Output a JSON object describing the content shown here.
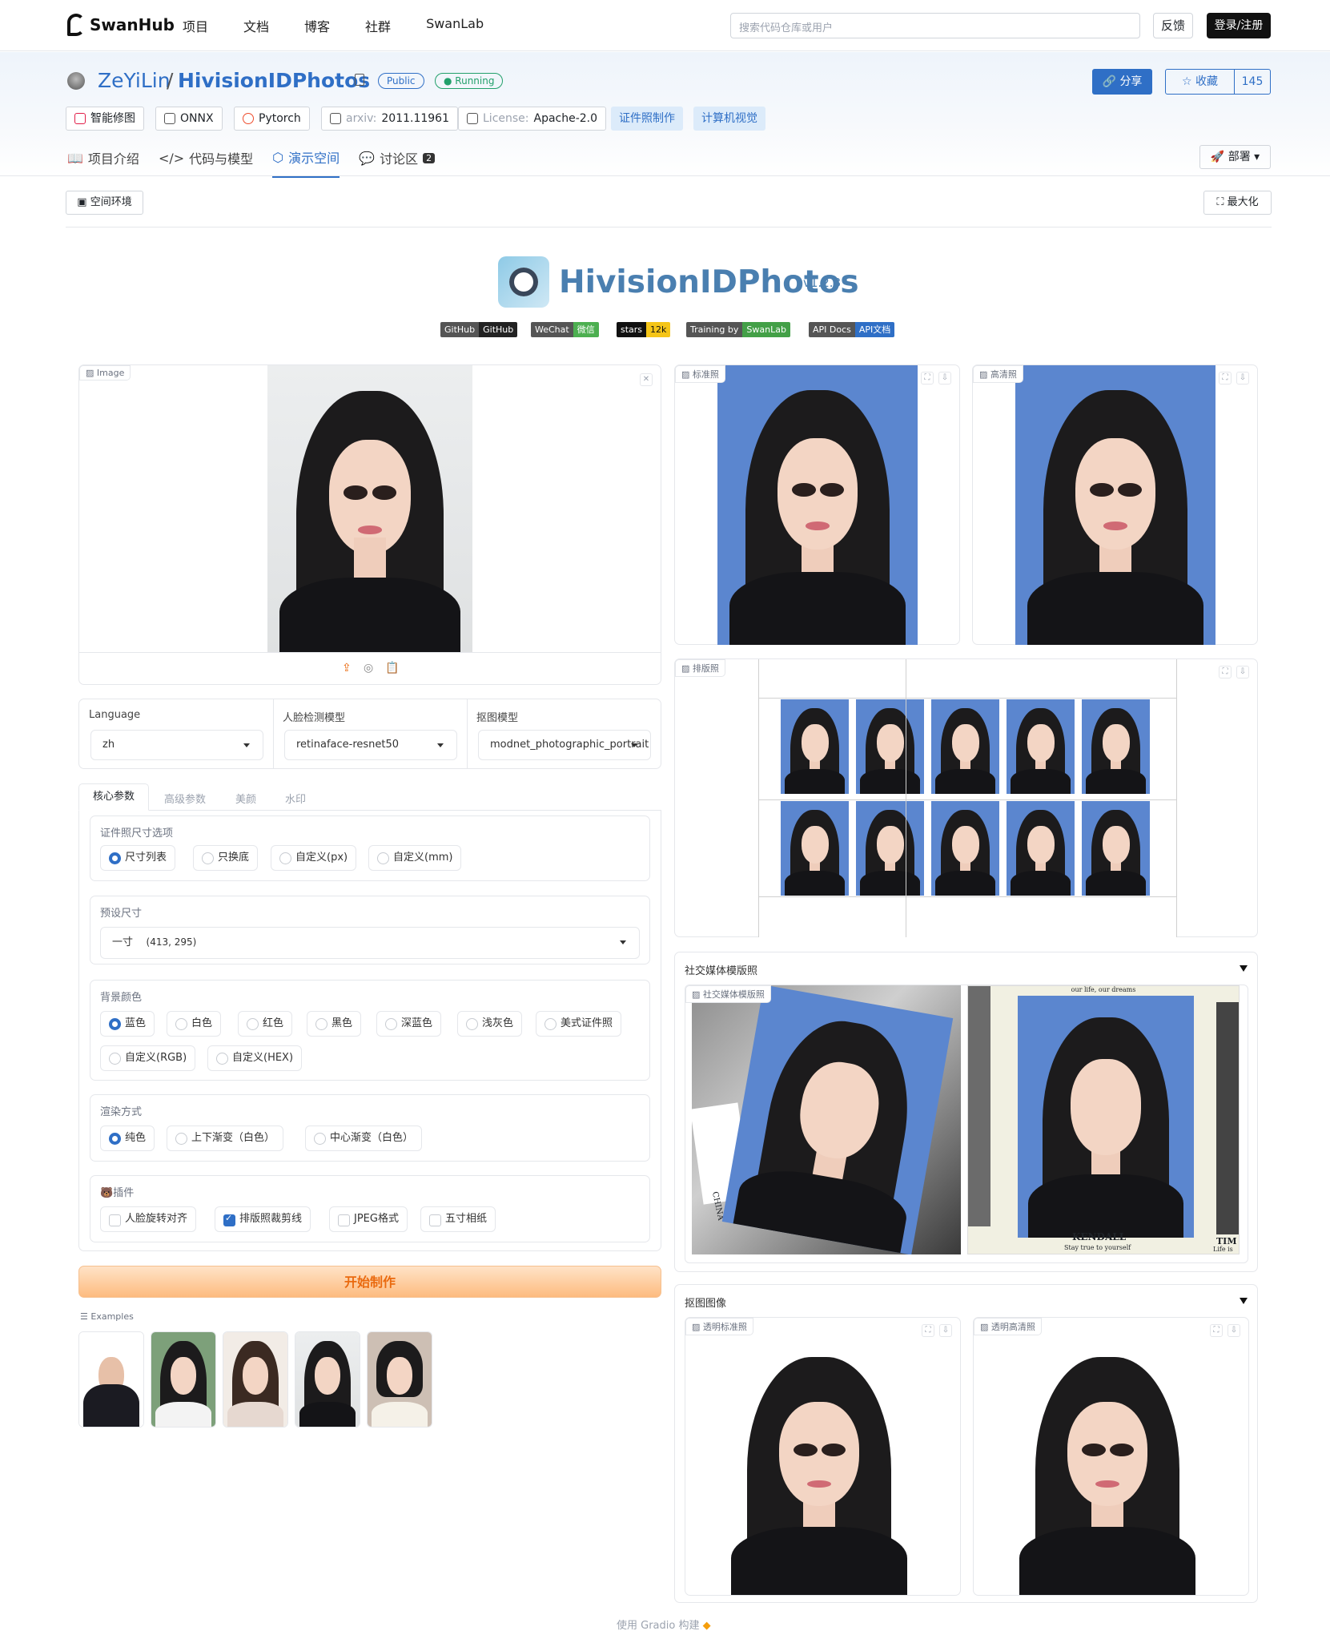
{
  "nav": {
    "brand": "SwanHub",
    "links": [
      "项目",
      "文档",
      "博客",
      "社群",
      "SwanLab"
    ],
    "search_placeholder": "搜索代码仓库或用户",
    "feedback": "反馈",
    "login": "登录/注册"
  },
  "repo": {
    "owner": "ZeYiLin",
    "slash": "/",
    "name": "HivisionIDPhotos",
    "visibility": "Public",
    "status": "Running",
    "share": "分享",
    "star": "收藏",
    "star_count": "145",
    "tags": [
      {
        "icon": "edit-icon",
        "value": "智能修图"
      },
      {
        "icon": "onnx-icon",
        "value": "ONNX"
      },
      {
        "icon": "pytorch-icon",
        "value": "Pytorch"
      },
      {
        "icon": "paper-icon",
        "key": "arxiv:",
        "value": "2011.11961"
      },
      {
        "icon": "license-icon",
        "key": "License:",
        "value": "Apache-2.0"
      }
    ],
    "topics": [
      "证件照制作",
      "计算机视觉"
    ],
    "tabs": [
      "项目介绍",
      "代码与模型",
      "演示空间",
      "讨论区"
    ],
    "discussion_count": "2",
    "deploy": "部署",
    "env": "空间环境",
    "maximize": "最大化"
  },
  "app": {
    "title": "HivisionIDPhotos",
    "version": "v1.2.8",
    "shields": [
      {
        "l": "GitHub",
        "r": "GitHub",
        "lc": "#555555",
        "rc": "#222222"
      },
      {
        "l": "WeChat",
        "r": "微信",
        "lc": "#555555",
        "rc": "#4caf50"
      },
      {
        "l": "stars",
        "r": "12k",
        "lc": "#111111",
        "rc": "#f5c518"
      },
      {
        "l": "Training by",
        "r": "SwanLab",
        "lc": "#555555",
        "rc": "#43a047"
      },
      {
        "l": "API Docs",
        "r": "API文档",
        "lc": "#555555",
        "rc": "#2f6fc6"
      }
    ]
  },
  "left": {
    "image_label": "Image",
    "language_label": "Language",
    "language_value": "zh",
    "face_model_label": "人脸检测模型",
    "face_model_value": "retinaface-resnet50",
    "matting_label": "抠图模型",
    "matting_value": "modnet_photographic_portrait",
    "param_tabs": [
      "核心参数",
      "高级参数",
      "美颜",
      "水印"
    ],
    "size_option_label": "证件照尺寸选项",
    "size_options": [
      "尺寸列表",
      "只换底",
      "自定义(px)",
      "自定义(mm)"
    ],
    "preset_label": "预设尺寸",
    "preset_value": "一寸",
    "preset_dims": "(413, 295)",
    "bg_label": "背景颜色",
    "bg_options": [
      "蓝色",
      "白色",
      "红色",
      "黑色",
      "深蓝色",
      "浅灰色",
      "美式证件照",
      "自定义(RGB)",
      "自定义(HEX)"
    ],
    "render_label": "渲染方式",
    "render_options": [
      "纯色",
      "上下渐变（白色）",
      "中心渐变（白色）"
    ],
    "plugin_label": "插件",
    "plugin_options": [
      "人脸旋转对齐",
      "排版照裁剪线",
      "JPEG格式",
      "五寸相纸"
    ],
    "submit": "开始制作",
    "examples_label": "Examples"
  },
  "right": {
    "standard": "标准照",
    "hd": "高清照",
    "layout": "排版照",
    "social_section": "社交媒体模版照",
    "social_label": "社交媒体模版照",
    "matting_section": "抠图图像",
    "transparent_std": "透明标准照",
    "transparent_hd": "透明高清照",
    "kendall_name": "KENDALL",
    "kendall_tagline": "Stay true to yourself",
    "kendall_top": "our life, our dreams",
    "tim_name": "TIM",
    "tim_tagline": "Life is",
    "china_text": "CHINA"
  },
  "footer": {
    "text": "使用 Gradio 构建"
  }
}
